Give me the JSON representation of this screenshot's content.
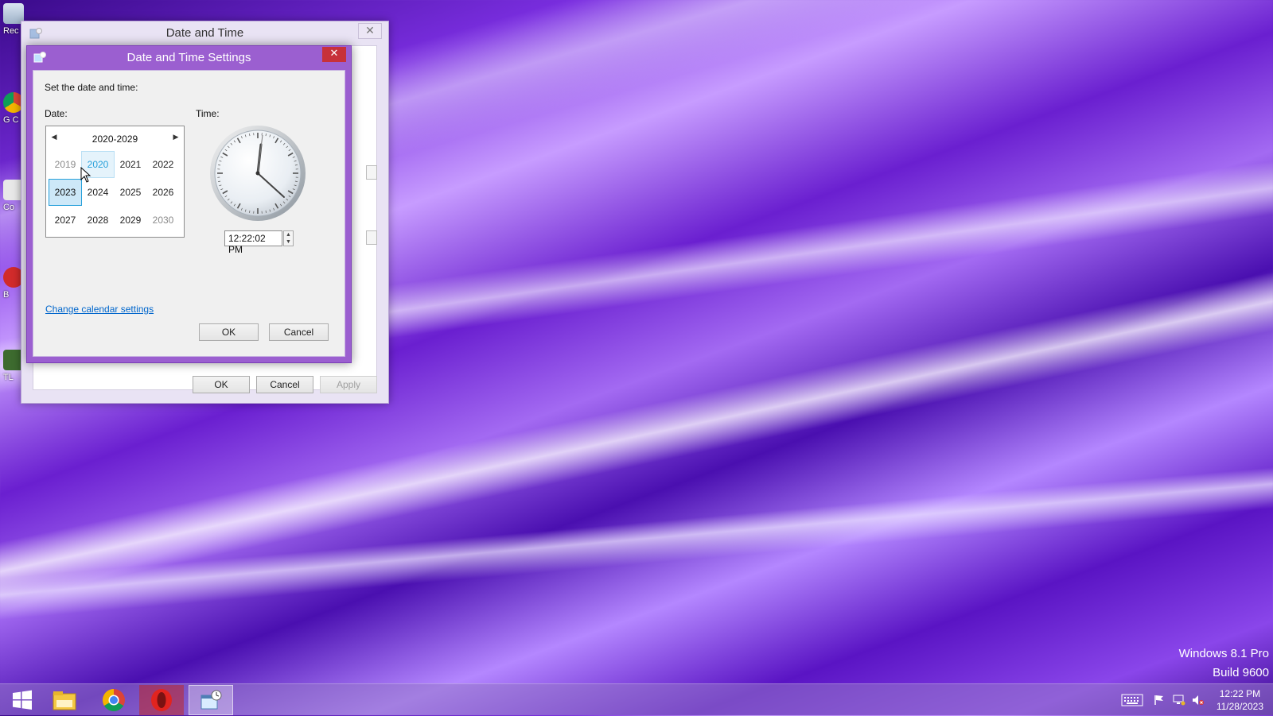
{
  "desktop": {
    "icons": [
      {
        "label": "Rec"
      },
      {
        "label": "G C"
      },
      {
        "label": "Co"
      },
      {
        "label": "B"
      },
      {
        "label": "TL"
      }
    ],
    "watermark": {
      "line1": "Windows 8.1 Pro",
      "line2": "Build 9600"
    }
  },
  "outer_window": {
    "title": "Date and Time",
    "buttons": {
      "ok": "OK",
      "cancel": "Cancel",
      "apply": "Apply"
    }
  },
  "inner_dialog": {
    "title": "Date and Time Settings",
    "instruction": "Set the date and time:",
    "date_label": "Date:",
    "time_label": "Time:",
    "calendar": {
      "range": "2020-2029",
      "years": [
        {
          "label": "2019",
          "state": "dim"
        },
        {
          "label": "2020",
          "state": "hover"
        },
        {
          "label": "2021",
          "state": "normal"
        },
        {
          "label": "2022",
          "state": "normal"
        },
        {
          "label": "2023",
          "state": "selected"
        },
        {
          "label": "2024",
          "state": "normal"
        },
        {
          "label": "2025",
          "state": "normal"
        },
        {
          "label": "2026",
          "state": "normal"
        },
        {
          "label": "2027",
          "state": "normal"
        },
        {
          "label": "2028",
          "state": "normal"
        },
        {
          "label": "2029",
          "state": "normal"
        },
        {
          "label": "2030",
          "state": "dim"
        }
      ]
    },
    "time_value": "12:22:02 PM",
    "link": "Change calendar settings",
    "buttons": {
      "ok": "OK",
      "cancel": "Cancel"
    }
  },
  "taskbar": {
    "items": [
      {
        "icon": "windows-start-icon"
      },
      {
        "icon": "file-explorer-icon"
      },
      {
        "icon": "chrome-icon"
      },
      {
        "icon": "opera-icon"
      },
      {
        "icon": "date-time-icon"
      }
    ],
    "tray": {
      "time": "12:22 PM",
      "date": "11/28/2023"
    }
  },
  "colors": {
    "accent": "#9b5fd0",
    "close_red": "#c7313a",
    "link_blue": "#0066cc",
    "selection_blue": "#26a0da"
  }
}
